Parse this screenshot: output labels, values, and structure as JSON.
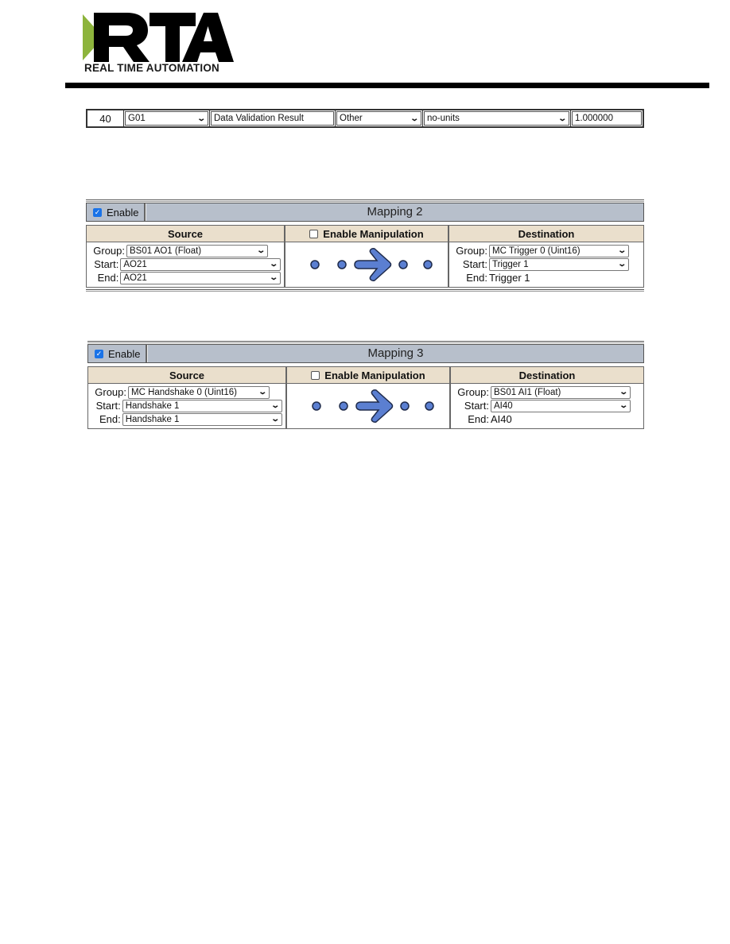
{
  "header": {
    "logo_letters": "RTA",
    "logo_tagline": "REAL TIME AUTOMATION",
    "colors": {
      "logo_green": "#8db43c",
      "logo_black": "#000000"
    }
  },
  "point_row": {
    "index": "40",
    "group_select": "G01",
    "description": "Data Validation Result",
    "type_select": "Other",
    "units_select": "no-units",
    "value": "1.000000"
  },
  "mappings": [
    {
      "enable_label": "Enable",
      "enabled": true,
      "title": "Mapping 2",
      "source": {
        "header": "Source",
        "group_label": "Group:",
        "group_value": "BS01 AO1 (Float)",
        "start_label": "Start:",
        "start_value": "AO21",
        "end_label": "End:",
        "end_value": "AO21"
      },
      "manipulation": {
        "label": "Enable Manipulation",
        "enabled": false
      },
      "destination": {
        "header": "Destination",
        "group_label": "Group:",
        "group_value": "MC Trigger 0 (Uint16)",
        "start_label": "Start:",
        "start_value": "Trigger 1",
        "end_label": "End:",
        "end_value": "Trigger 1"
      }
    },
    {
      "enable_label": "Enable",
      "enabled": true,
      "title": "Mapping 3",
      "source": {
        "header": "Source",
        "group_label": "Group:",
        "group_value": "MC Handshake 0 (Uint16)",
        "start_label": "Start:",
        "start_value": "Handshake 1",
        "end_label": "End:",
        "end_value": "Handshake 1"
      },
      "manipulation": {
        "label": "Enable Manipulation",
        "enabled": false
      },
      "destination": {
        "header": "Destination",
        "group_label": "Group:",
        "group_value": "BS01 AI1 (Float)",
        "start_label": "Start:",
        "start_value": "AI40",
        "end_label": "End:",
        "end_value": "AI40"
      }
    }
  ],
  "colors": {
    "header_bar": "#b7bfcb",
    "column_header": "#eadfcc",
    "arrow_fill": "#5b7fd1",
    "checkbox_accent": "#1a73e8"
  }
}
